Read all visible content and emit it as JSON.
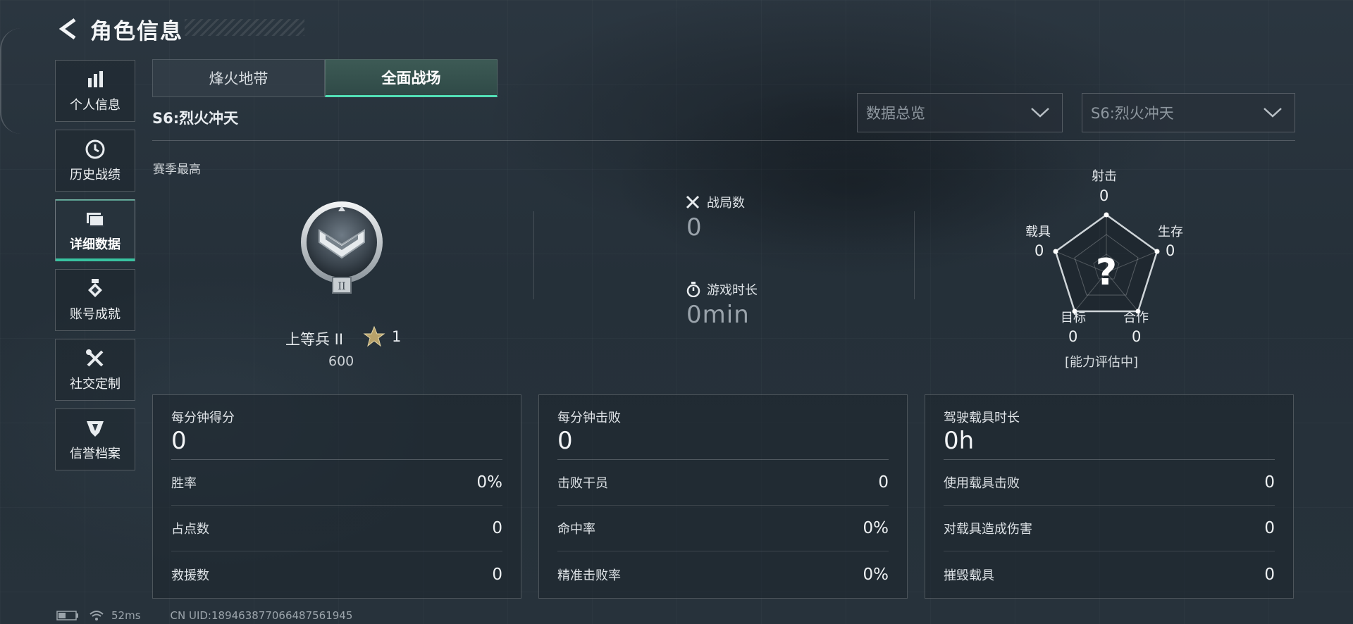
{
  "header": {
    "title": "角色信息"
  },
  "sidebar": {
    "items": [
      {
        "label": "个人信息",
        "icon": "bar-chart-icon"
      },
      {
        "label": "历史战绩",
        "icon": "history-clock-icon"
      },
      {
        "label": "详细数据",
        "icon": "folder-data-icon",
        "active": true
      },
      {
        "label": "账号成就",
        "icon": "medal-icon"
      },
      {
        "label": "社交定制",
        "icon": "tools-icon"
      },
      {
        "label": "信誉档案",
        "icon": "shield-badge-icon"
      }
    ]
  },
  "tabs": [
    {
      "label": "烽火地带",
      "active": false
    },
    {
      "label": "全面战场",
      "active": true
    }
  ],
  "season": {
    "label": "S6:烈火冲天"
  },
  "filters": {
    "overview": "数据总览",
    "season": "S6:烈火冲天"
  },
  "rank": {
    "section_label": "赛季最高",
    "name": "上等兵 II",
    "stars": "1",
    "score": "600"
  },
  "battle": {
    "matches_label": "战局数",
    "matches_value": "0",
    "playtime_label": "游戏时长",
    "playtime_value": "0min"
  },
  "radar": {
    "shooting_label": "射击",
    "shooting_value": "0",
    "survival_label": "生存",
    "survival_value": "0",
    "teamwork_label": "合作",
    "teamwork_value": "0",
    "objective_label": "目标",
    "objective_value": "0",
    "vehicle_label": "载具",
    "vehicle_value": "0",
    "center_mark": "?",
    "status": "[能力评估中]"
  },
  "cards": [
    {
      "title": "每分钟得分",
      "value": "0",
      "rows": [
        {
          "label": "胜率",
          "value": "0%"
        },
        {
          "label": "占点数",
          "value": "0"
        },
        {
          "label": "救援数",
          "value": "0"
        }
      ]
    },
    {
      "title": "每分钟击败",
      "value": "0",
      "rows": [
        {
          "label": "击败干员",
          "value": "0"
        },
        {
          "label": "命中率",
          "value": "0%"
        },
        {
          "label": "精准击败率",
          "value": "0%"
        }
      ]
    },
    {
      "title": "驾驶载具时长",
      "value": "0h",
      "rows": [
        {
          "label": "使用载具击败",
          "value": "0"
        },
        {
          "label": "对载具造成伤害",
          "value": "0"
        },
        {
          "label": "摧毁载具",
          "value": "0"
        }
      ]
    }
  ],
  "footer": {
    "ping": "52ms",
    "uid": "CN UID:18946387706648756​1945"
  },
  "colors": {
    "accent": "#52e0b6",
    "background": "#27323b"
  }
}
